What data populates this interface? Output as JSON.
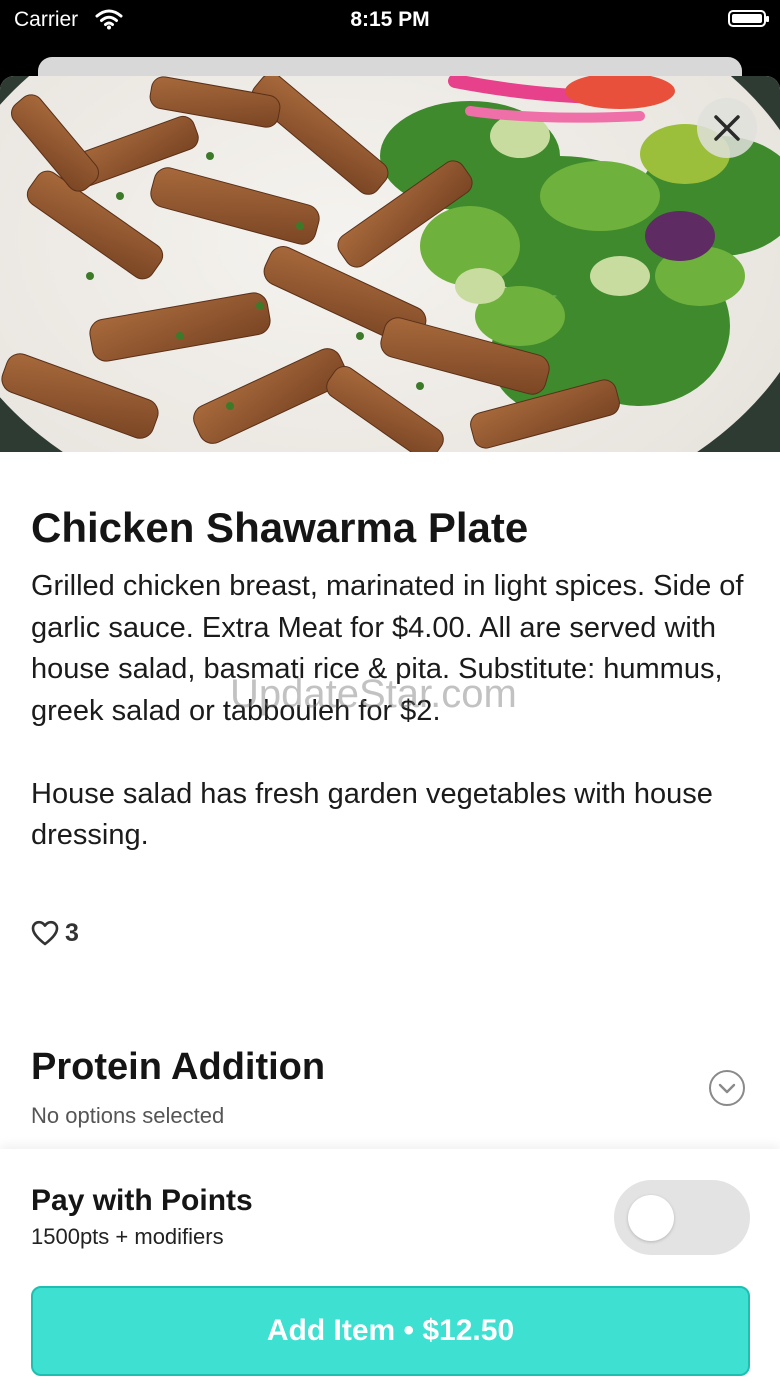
{
  "status_bar": {
    "carrier": "Carrier",
    "time": "8:15 PM",
    "wifi_icon": "wifi-icon",
    "battery_icon": "battery-icon"
  },
  "item": {
    "image_alt": "Chicken shawarma plate with house salad",
    "title": "Chicken Shawarma Plate",
    "description": [
      "Grilled chicken breast, marinated in light spices. Side of garlic sauce. Extra Meat for $4.00. All are served with house salad, basmati rice & pita. Substitute: hummus, greek salad or tabbouleh for $2.",
      "House salad has fresh garden vegetables with house dressing."
    ],
    "likes": "3",
    "like_icon": "heart-icon"
  },
  "watermark": "UpdateStar.com",
  "modifier_group": {
    "title": "Protein Addition",
    "status": "No options selected",
    "icon": "chevron-down-icon"
  },
  "footer": {
    "pay_title": "Pay with Points",
    "pay_subtitle": "1500pts + modifiers",
    "toggle_on": false,
    "add_button_label": "Add Item • $12.50"
  },
  "colors": {
    "accent": "#3ee0d2",
    "accent_border": "#1ebfb1",
    "text": "#151515"
  }
}
